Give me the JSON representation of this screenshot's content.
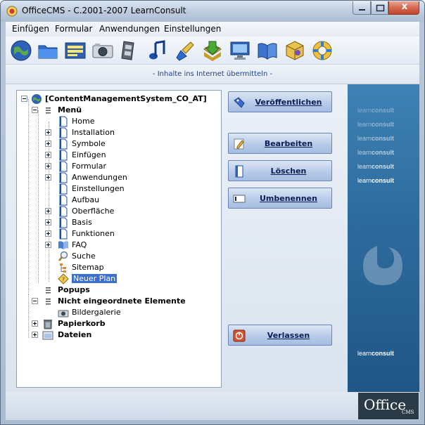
{
  "window": {
    "title": "OfficeCMS - C.2001-2007 LearnConsult",
    "close_glyph": "x"
  },
  "menu": [
    {
      "label": "Einfügen"
    },
    {
      "label": "Formular"
    },
    {
      "label": "Anwendungen"
    },
    {
      "label": "Einstellungen"
    }
  ],
  "toolbar": [
    {
      "icon": "globe-icon"
    },
    {
      "icon": "folder-icon"
    },
    {
      "icon": "form-icon"
    },
    {
      "icon": "camera-icon"
    },
    {
      "icon": "film-icon"
    },
    {
      "icon": "music-note-icon"
    },
    {
      "icon": "brush-icon"
    },
    {
      "icon": "download-icon"
    },
    {
      "icon": "screen-icon"
    },
    {
      "icon": "book-icon"
    },
    {
      "icon": "cube-icon"
    },
    {
      "icon": "lifebuoy-icon"
    }
  ],
  "infobar": {
    "text": "- Inhalte ins Internet übermitteln -"
  },
  "tree": {
    "rows": [
      {
        "label": "[ContentManagementSystem_CO_AT]",
        "bold": true
      },
      {
        "label": "Menü",
        "bold": true
      },
      {
        "label": "Home"
      },
      {
        "label": "Installation"
      },
      {
        "label": "Symbole"
      },
      {
        "label": "Einfügen"
      },
      {
        "label": "Formular"
      },
      {
        "label": "Anwendungen"
      },
      {
        "label": "Einstellungen"
      },
      {
        "label": "Aufbau"
      },
      {
        "label": "Oberfläche"
      },
      {
        "label": "Basis"
      },
      {
        "label": "Funktionen"
      },
      {
        "label": "FAQ"
      },
      {
        "label": "Suche"
      },
      {
        "label": "Sitemap"
      },
      {
        "label": "Neuer Plan",
        "selected": true
      },
      {
        "label": "Popups",
        "bold": true
      },
      {
        "label": "Nicht eingeordnete Elemente",
        "bold": true
      },
      {
        "label": "Bildergalerie"
      },
      {
        "label": "Papierkorb",
        "bold": true
      },
      {
        "label": "Dateien",
        "bold": true
      }
    ]
  },
  "buttons": {
    "publish": "Veröffentlichen",
    "edit": "Bearbeiten",
    "delete": "Löschen",
    "rename": "Umbenennen",
    "exit": "Verlassen"
  },
  "brand": {
    "word_a": "learn",
    "word_b": "consult",
    "logo": "Office",
    "logo_sub": "CMS"
  },
  "colors": {
    "accent": "#2f6d9f",
    "selection": "#3a6fd0",
    "button_text": "#0c1f55"
  }
}
